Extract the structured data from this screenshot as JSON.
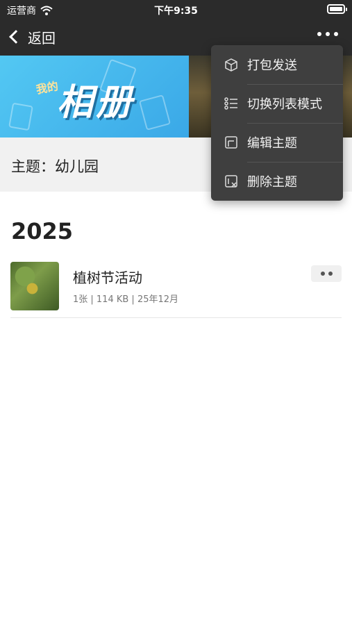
{
  "status_bar": {
    "carrier": "运营商",
    "time": "下午9:35"
  },
  "nav": {
    "back_label": "返回"
  },
  "banner": {
    "small_title": "我的",
    "big_title": "相册"
  },
  "theme": {
    "label": "主题：幼儿园"
  },
  "year": "2025",
  "albums": [
    {
      "name": "植树节活动",
      "meta": "1张 | 114 KB | 25年12月"
    }
  ],
  "menu": {
    "items": [
      {
        "label": "打包发送",
        "icon": "package-icon"
      },
      {
        "label": "切换列表模式",
        "icon": "list-icon"
      },
      {
        "label": "编辑主题",
        "icon": "edit-icon"
      },
      {
        "label": "删除主题",
        "icon": "delete-icon"
      }
    ]
  },
  "colors": {
    "topbar": "#2b2b2b",
    "menu_bg": "#3f3f3f",
    "banner_blue": "#53c8f3"
  }
}
